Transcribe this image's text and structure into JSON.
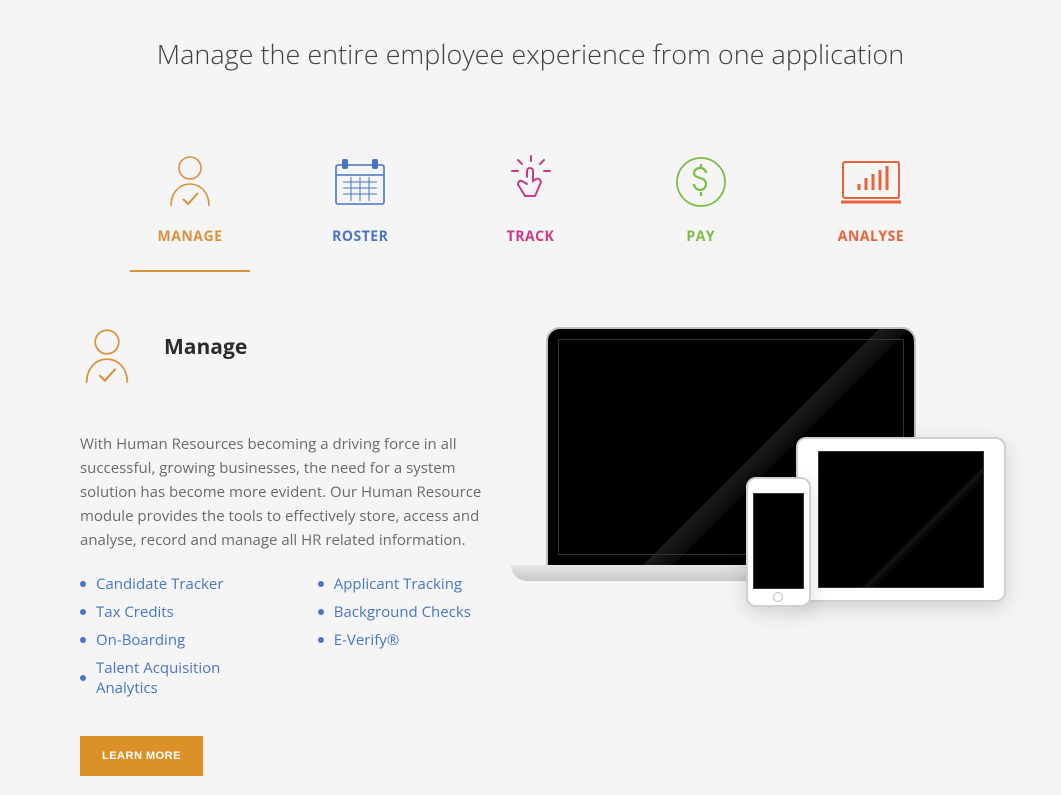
{
  "page_title": "Manage the entire employee experience from one application",
  "tabs": [
    {
      "id": "manage",
      "label": "MANAGE",
      "color": "#d8923c",
      "icon": "person-check-icon",
      "active": true
    },
    {
      "id": "roster",
      "label": "ROSTER",
      "color": "#4a75c2",
      "icon": "calendar-icon",
      "active": false
    },
    {
      "id": "track",
      "label": "TRACK",
      "color": "#c93b86",
      "icon": "tap-icon",
      "active": false
    },
    {
      "id": "pay",
      "label": "PAY",
      "color": "#7ebc44",
      "icon": "dollar-circle-icon",
      "active": false
    },
    {
      "id": "analyse",
      "label": "ANALYSE",
      "color": "#e8613b",
      "icon": "bar-chart-icon",
      "active": false
    }
  ],
  "section": {
    "title": "Manage",
    "description": "With Human Resources becoming a driving force in all successful, growing businesses, the need for a system solution has become more evident. Our Human Resource module provides the tools to effectively store, access and analyse, record and manage all HR related information.",
    "features_col1": [
      "Candidate Tracker",
      "Tax Credits",
      "On-Boarding",
      "Talent Acquisition Analytics"
    ],
    "features_col2": [
      "Applicant Tracking",
      "Background Checks",
      "E-Verify®"
    ],
    "learn_more_label": "LEARN MORE"
  }
}
